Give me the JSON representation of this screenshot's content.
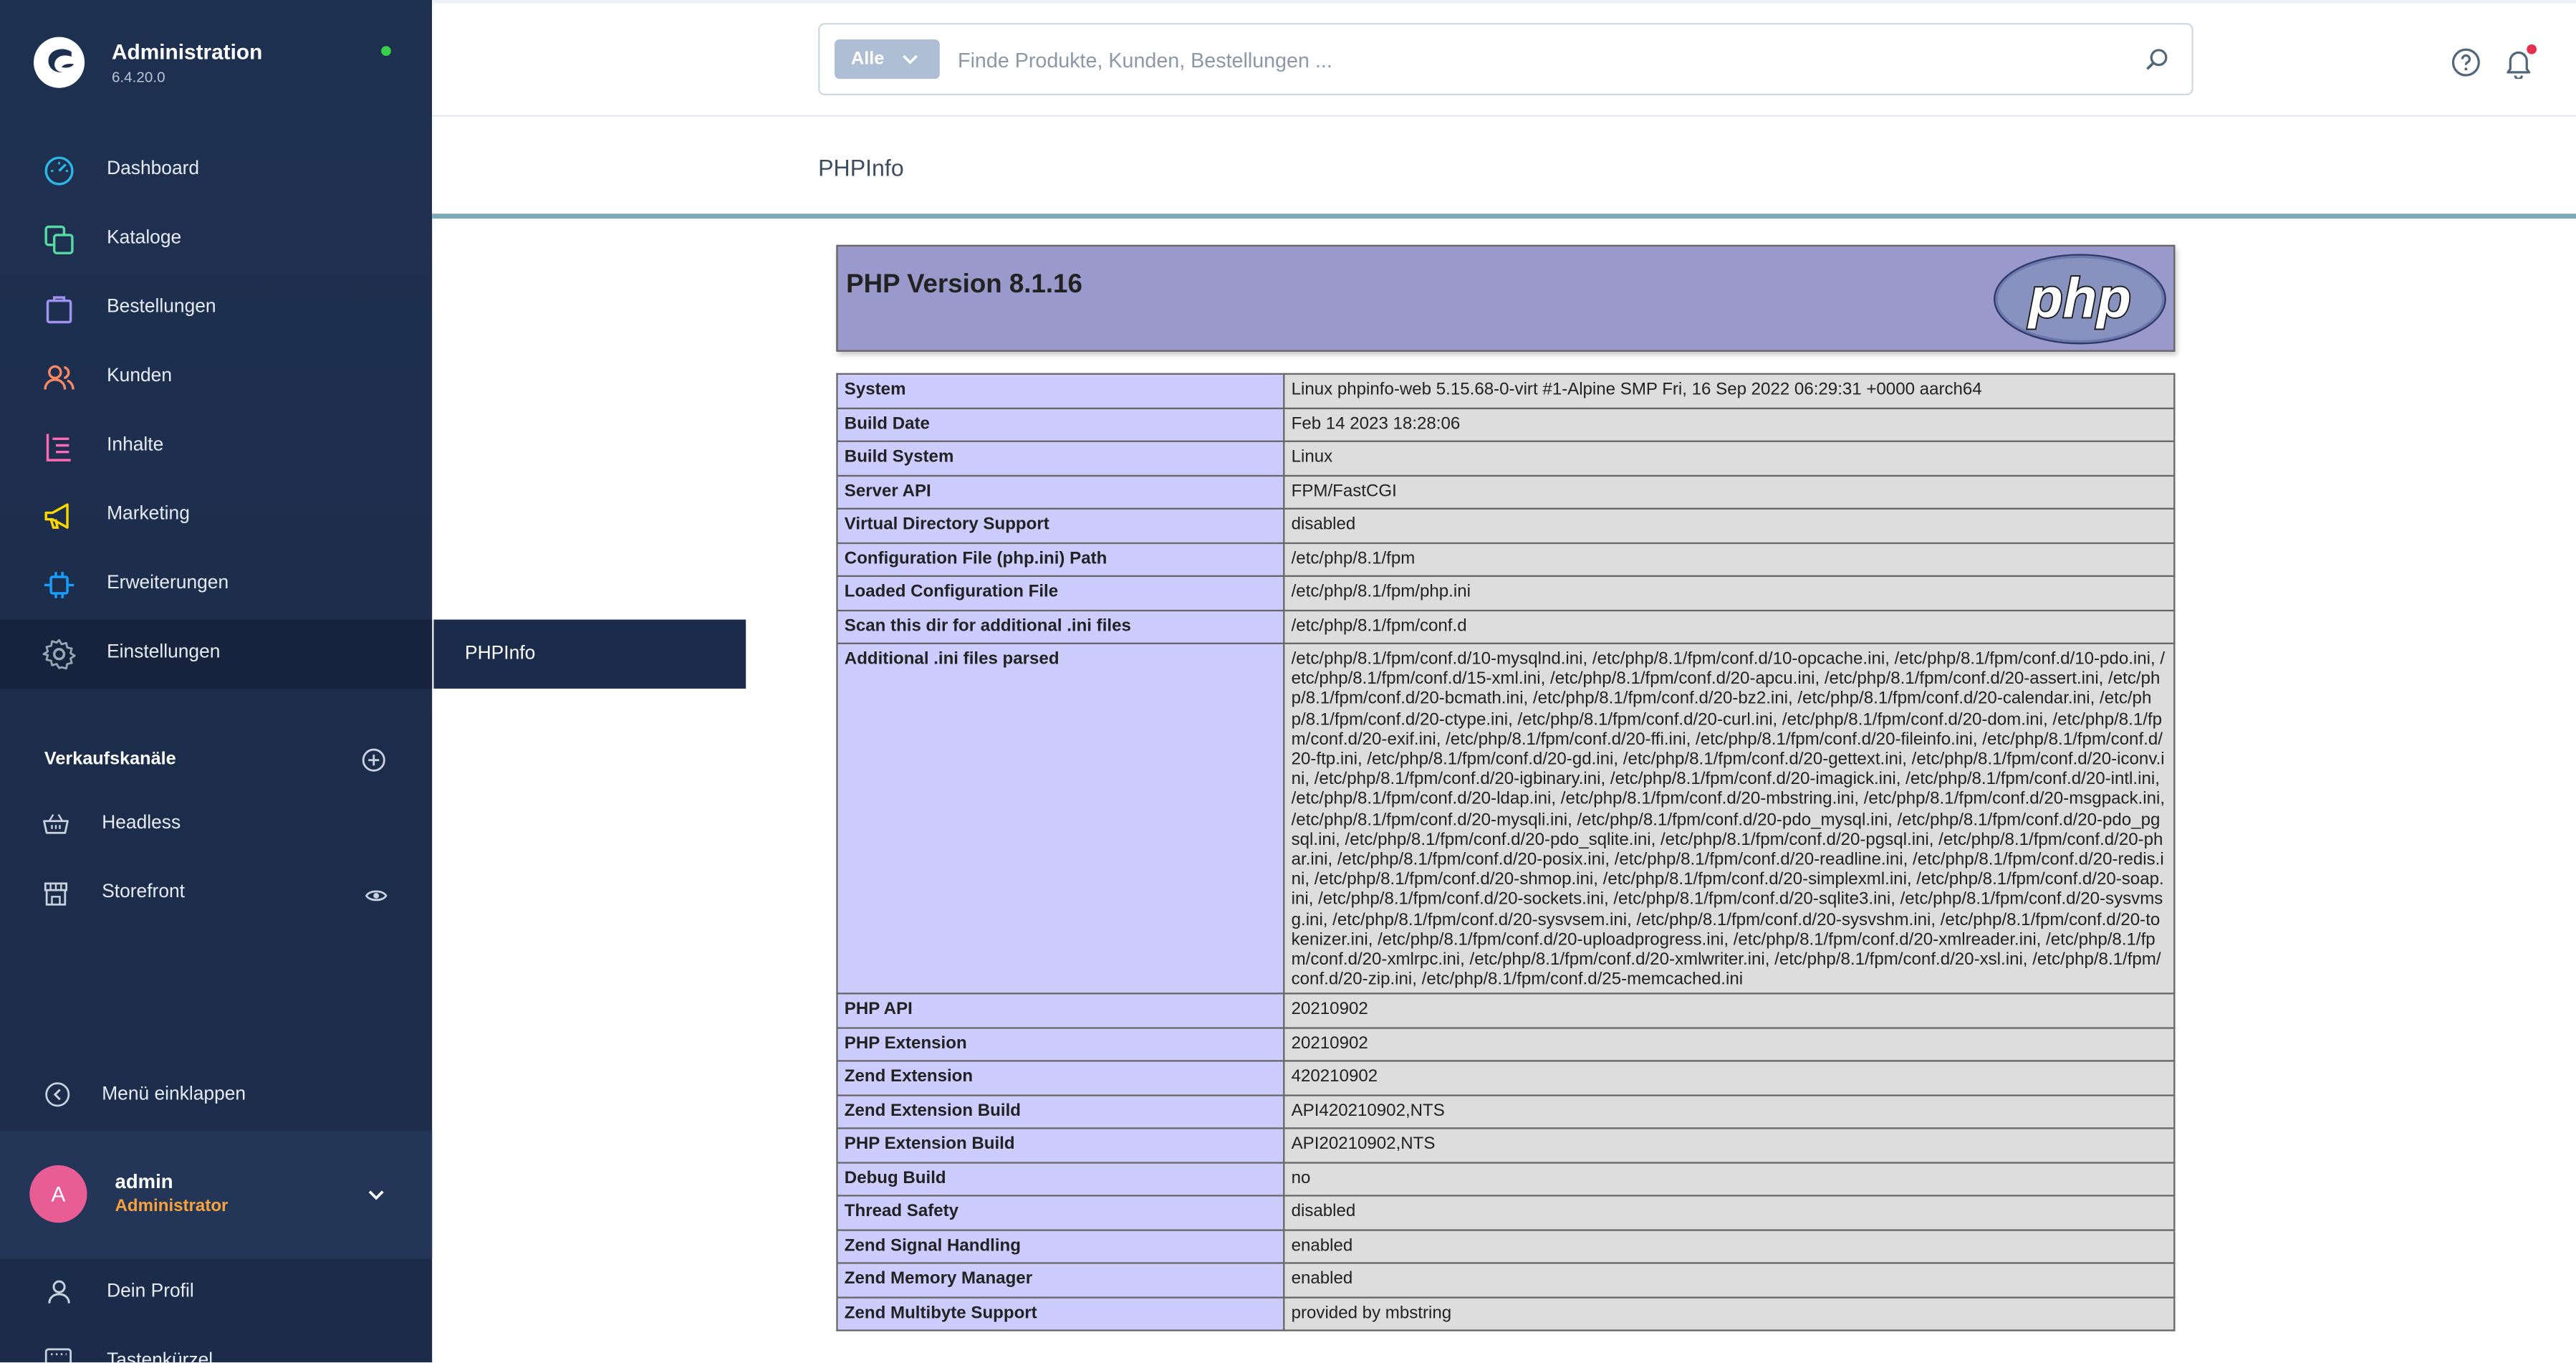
{
  "app": {
    "title": "Administration",
    "version": "6.4.20.0"
  },
  "nav": [
    {
      "label": "Dashboard",
      "icon": "dashboard-icon",
      "color": "#2bb6e5"
    },
    {
      "label": "Kataloge",
      "icon": "catalog-icon",
      "color": "#57d9a3"
    },
    {
      "label": "Bestellungen",
      "icon": "shopping-bag-icon",
      "color": "#a092f0"
    },
    {
      "label": "Kunden",
      "icon": "users-icon",
      "color": "#f88962"
    },
    {
      "label": "Inhalte",
      "icon": "content-icon",
      "color": "#ff68b4"
    },
    {
      "label": "Marketing",
      "icon": "megaphone-icon",
      "color": "#ffd700"
    },
    {
      "label": "Erweiterungen",
      "icon": "plug-icon",
      "color": "#189eff"
    },
    {
      "label": "Einstellungen",
      "icon": "gear-icon",
      "color": "#9aa8b5"
    }
  ],
  "sales_channels": {
    "title": "Verkaufskanäle",
    "items": [
      {
        "label": "Headless",
        "icon": "basket-icon"
      },
      {
        "label": "Storefront",
        "icon": "storefront-icon"
      }
    ]
  },
  "collapse_label": "Menü einklappen",
  "user": {
    "initial": "A",
    "name": "admin",
    "role": "Administrator"
  },
  "profile_label": "Dein Profil",
  "shortcuts_label": "Tastenkürzel",
  "search": {
    "type_label": "Alle",
    "placeholder": "Finde Produkte, Kunden, Bestellungen ..."
  },
  "page_title": "PHPInfo",
  "subnav_label": "PHPInfo",
  "php": {
    "version_heading": "PHP Version 8.1.16",
    "logo_text": "php",
    "rows": [
      {
        "key": "System",
        "value": "Linux phpinfo-web 5.15.68-0-virt #1-Alpine SMP Fri, 16 Sep 2022 06:29:31 +0000 aarch64"
      },
      {
        "key": "Build Date",
        "value": "Feb 14 2023 18:28:06"
      },
      {
        "key": "Build System",
        "value": "Linux"
      },
      {
        "key": "Server API",
        "value": "FPM/FastCGI"
      },
      {
        "key": "Virtual Directory Support",
        "value": "disabled"
      },
      {
        "key": "Configuration File (php.ini) Path",
        "value": "/etc/php/8.1/fpm"
      },
      {
        "key": "Loaded Configuration File",
        "value": "/etc/php/8.1/fpm/php.ini"
      },
      {
        "key": "Scan this dir for additional .ini files",
        "value": "/etc/php/8.1/fpm/conf.d"
      },
      {
        "key": "Additional .ini files parsed",
        "value": "/etc/php/8.1/fpm/conf.d/10-mysqlnd.ini, /etc/php/8.1/fpm/conf.d/10-opcache.ini, /etc/php/8.1/fpm/conf.d/10-pdo.ini, /etc/php/8.1/fpm/conf.d/15-xml.ini, /etc/php/8.1/fpm/conf.d/20-apcu.ini, /etc/php/8.1/fpm/conf.d/20-assert.ini, /etc/php/8.1/fpm/conf.d/20-bcmath.ini, /etc/php/8.1/fpm/conf.d/20-bz2.ini, /etc/php/8.1/fpm/conf.d/20-calendar.ini, /etc/php/8.1/fpm/conf.d/20-ctype.ini, /etc/php/8.1/fpm/conf.d/20-curl.ini, /etc/php/8.1/fpm/conf.d/20-dom.ini, /etc/php/8.1/fpm/conf.d/20-exif.ini, /etc/php/8.1/fpm/conf.d/20-ffi.ini, /etc/php/8.1/fpm/conf.d/20-fileinfo.ini, /etc/php/8.1/fpm/conf.d/20-ftp.ini, /etc/php/8.1/fpm/conf.d/20-gd.ini, /etc/php/8.1/fpm/conf.d/20-gettext.ini, /etc/php/8.1/fpm/conf.d/20-iconv.ini, /etc/php/8.1/fpm/conf.d/20-igbinary.ini, /etc/php/8.1/fpm/conf.d/20-imagick.ini, /etc/php/8.1/fpm/conf.d/20-intl.ini, /etc/php/8.1/fpm/conf.d/20-ldap.ini, /etc/php/8.1/fpm/conf.d/20-mbstring.ini, /etc/php/8.1/fpm/conf.d/20-msgpack.ini, /etc/php/8.1/fpm/conf.d/20-mysqli.ini, /etc/php/8.1/fpm/conf.d/20-pdo_mysql.ini, /etc/php/8.1/fpm/conf.d/20-pdo_pgsql.ini, /etc/php/8.1/fpm/conf.d/20-pdo_sqlite.ini, /etc/php/8.1/fpm/conf.d/20-pgsql.ini, /etc/php/8.1/fpm/conf.d/20-phar.ini, /etc/php/8.1/fpm/conf.d/20-posix.ini, /etc/php/8.1/fpm/conf.d/20-readline.ini, /etc/php/8.1/fpm/conf.d/20-redis.ini, /etc/php/8.1/fpm/conf.d/20-shmop.ini, /etc/php/8.1/fpm/conf.d/20-simplexml.ini, /etc/php/8.1/fpm/conf.d/20-soap.ini, /etc/php/8.1/fpm/conf.d/20-sockets.ini, /etc/php/8.1/fpm/conf.d/20-sqlite3.ini, /etc/php/8.1/fpm/conf.d/20-sysvmsg.ini, /etc/php/8.1/fpm/conf.d/20-sysvsem.ini, /etc/php/8.1/fpm/conf.d/20-sysvshm.ini, /etc/php/8.1/fpm/conf.d/20-tokenizer.ini, /etc/php/8.1/fpm/conf.d/20-uploadprogress.ini, /etc/php/8.1/fpm/conf.d/20-xmlreader.ini, /etc/php/8.1/fpm/conf.d/20-xmlrpc.ini, /etc/php/8.1/fpm/conf.d/20-xmlwriter.ini, /etc/php/8.1/fpm/conf.d/20-xsl.ini, /etc/php/8.1/fpm/conf.d/20-zip.ini, /etc/php/8.1/fpm/conf.d/25-memcached.ini"
      },
      {
        "key": "PHP API",
        "value": "20210902"
      },
      {
        "key": "PHP Extension",
        "value": "20210902"
      },
      {
        "key": "Zend Extension",
        "value": "420210902"
      },
      {
        "key": "Zend Extension Build",
        "value": "API420210902,NTS"
      },
      {
        "key": "PHP Extension Build",
        "value": "API20210902,NTS"
      },
      {
        "key": "Debug Build",
        "value": "no"
      },
      {
        "key": "Thread Safety",
        "value": "disabled"
      },
      {
        "key": "Zend Signal Handling",
        "value": "enabled"
      },
      {
        "key": "Zend Memory Manager",
        "value": "enabled"
      },
      {
        "key": "Zend Multibyte Support",
        "value": "provided by mbstring"
      }
    ]
  }
}
